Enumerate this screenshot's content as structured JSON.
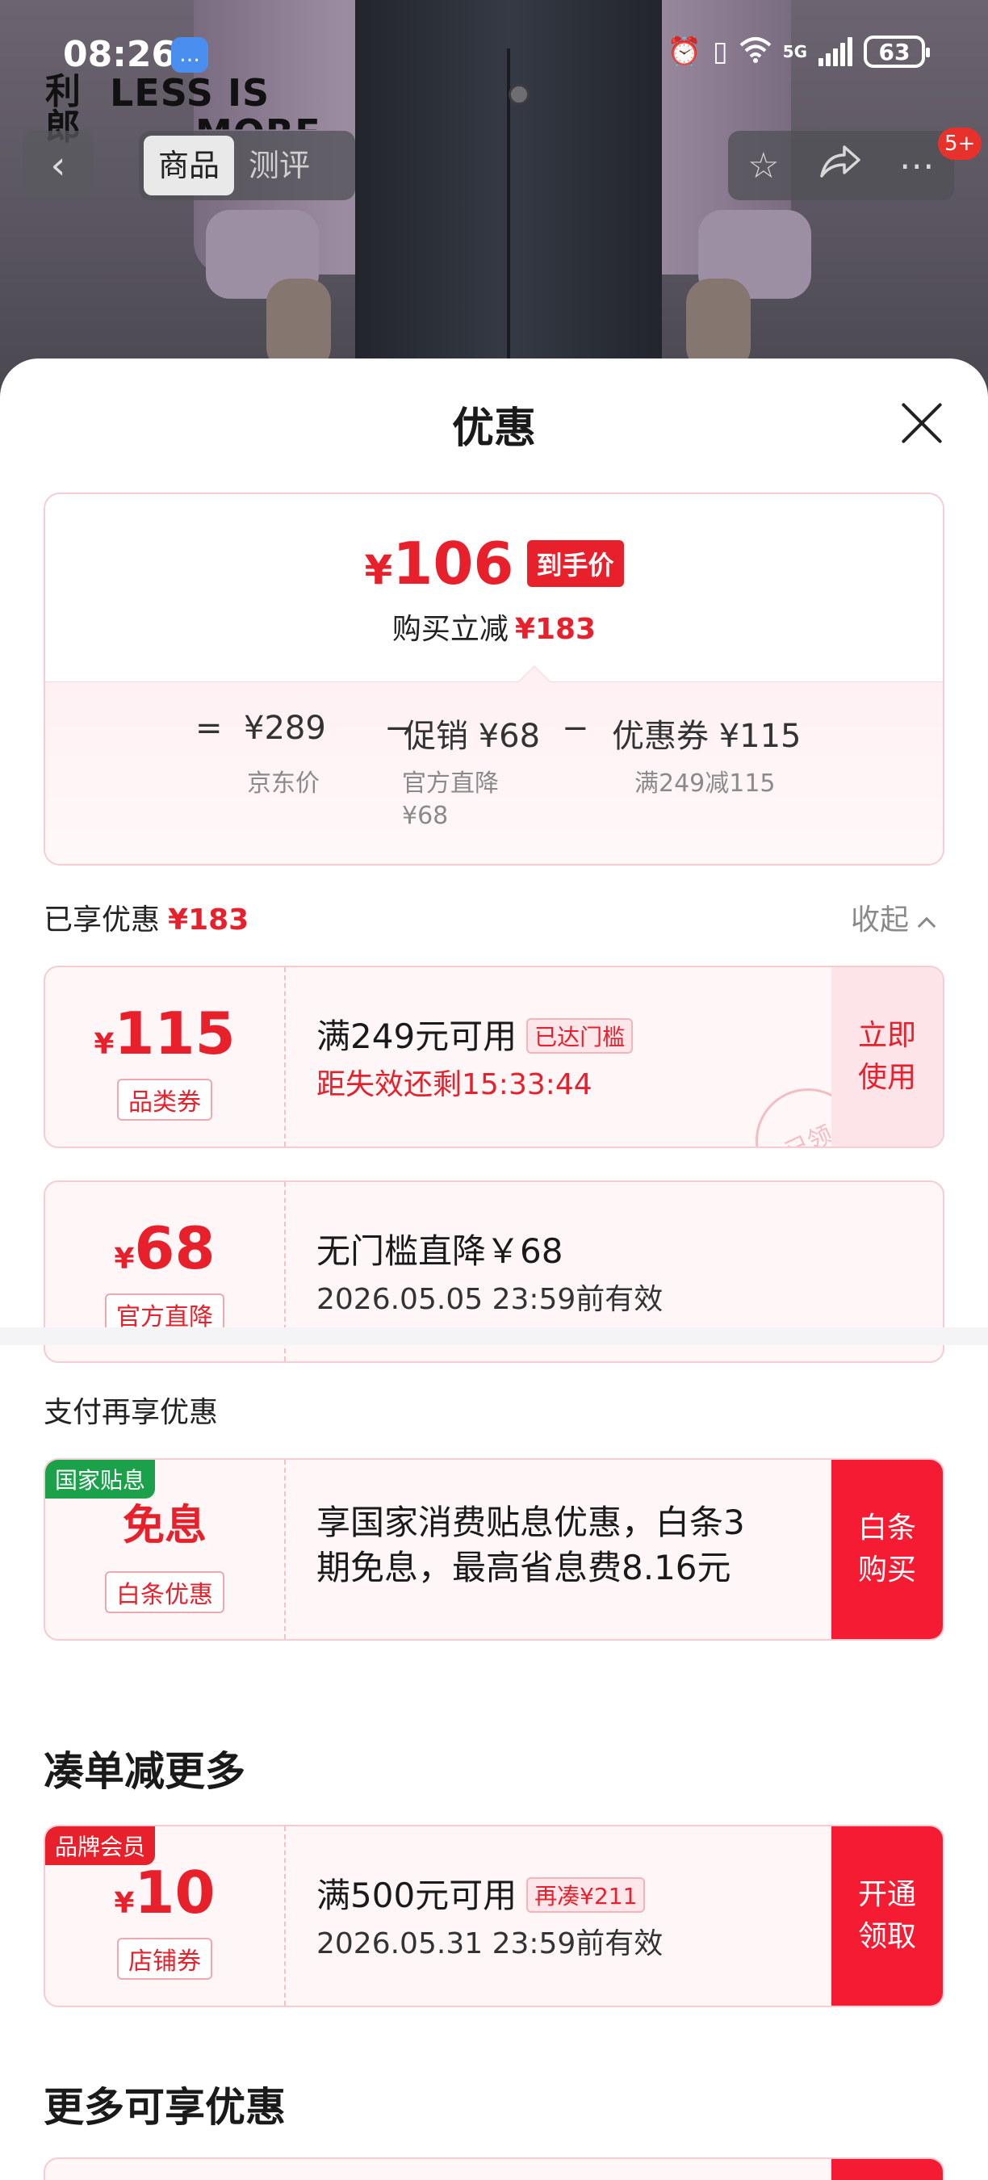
{
  "status_bar": {
    "time": "08:26",
    "battery": "63",
    "network": "5G"
  },
  "brand": {
    "cn": "利郎",
    "en_line1": "LESS IS",
    "en_line2": "MORE"
  },
  "nav": {
    "tabs": [
      "商品",
      "测评"
    ],
    "active_tab": 0,
    "badge": "5+"
  },
  "sheet": {
    "title": "优惠"
  },
  "price_summary": {
    "currency": "¥",
    "final_price": "106",
    "final_tag": "到手价",
    "save_label": "购买立减",
    "save_amount": "¥183",
    "formula": {
      "equals": "=",
      "base": "¥289",
      "minus1": "−",
      "promo": "促销 ¥68",
      "minus2": "−",
      "coupon": "优惠券 ¥115",
      "base_sub": "京东价",
      "promo_sub": "官方直降\n¥68",
      "coupon_sub": "满249减115"
    }
  },
  "enjoyed": {
    "label": "已享优惠",
    "amount": "¥183",
    "collapse_label": "收起"
  },
  "coupons": [
    {
      "currency": "¥",
      "amount": "115",
      "type": "品类券",
      "title": "满249元可用",
      "chip": "已达门槛",
      "sub": "距失效还剩15:33:44",
      "button": "立即使用",
      "stamp": "已领"
    },
    {
      "currency": "¥",
      "amount": "68",
      "type": "官方直降",
      "title": "无门槛直降￥68",
      "sub": "2026.05.05 23:59前有效"
    }
  ],
  "pay_section": {
    "label": "支付再享优惠",
    "card": {
      "corner": "国家贴息",
      "amount_text": "免息",
      "type": "白条优惠",
      "title": "享国家消费贴息优惠，白条3期免息，最高省息费8.16元",
      "button": "白条购买"
    }
  },
  "more_section": {
    "title": "凑单减更多",
    "card": {
      "corner": "品牌会员",
      "currency": "¥",
      "amount": "10",
      "type": "店铺券",
      "title": "满500元可用",
      "chip": "再凑¥211",
      "sub": "2026.05.31 23:59前有效",
      "button": "开通领取"
    }
  },
  "extra_section": {
    "title": "更多可享优惠"
  },
  "colors": {
    "accent_red": "#e8202b",
    "button_red": "#f51b32",
    "coupon_bg": "#fff6f7",
    "coupon_border": "#f6ccd2",
    "gov_green": "#1aa14a"
  }
}
